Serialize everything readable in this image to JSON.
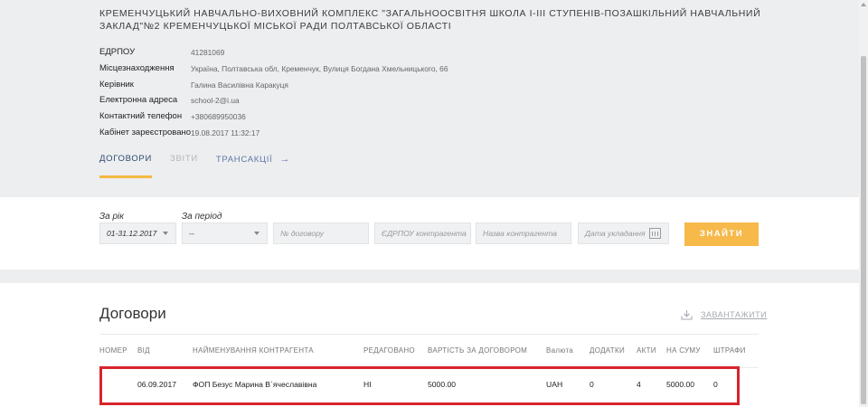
{
  "organization": {
    "title": "КРЕМЕНЧУЦЬКИЙ НАВЧАЛЬНО-ВИХОВНИЙ КОМПЛЕКС \"ЗАГАЛЬНООСВІТНЯ ШКОЛА І-ІІІ СТУПЕНІВ-ПОЗАШКІЛЬНИЙ НАВЧАЛЬНИЙ ЗАКЛАД\"№2 КРЕМЕНЧУЦЬКОЇ МІСЬКОЇ РАДИ ПОЛТАВСЬКОЇ ОБЛАСТІ",
    "info": [
      {
        "label": "ЕДРПОУ",
        "value": "41281069"
      },
      {
        "label": "Місцезнаходження",
        "value": "Україна, Полтавська обл, Кременчук, Вулиця Богдана Хмельницького, 66"
      },
      {
        "label": "Керівник",
        "value": "Галина Василівна Каракуця"
      },
      {
        "label": "Електронна адреса",
        "value": "school-2@i.ua"
      },
      {
        "label": "Контактний телефон",
        "value": "+380689950036"
      },
      {
        "label": "Кабінет зареєстровано",
        "value": "19.08.2017 11:32:17"
      }
    ]
  },
  "tabs": [
    {
      "label": "ДОГОВОРИ",
      "state": "active"
    },
    {
      "label": "ЗВІТИ",
      "state": "disabled"
    },
    {
      "label": "ТРАНСАКЦІЇ",
      "state": "link",
      "icon": "arrow-right-icon"
    }
  ],
  "filters": {
    "year_label": "За рік",
    "year_value": "01-31.12.2017",
    "period_label": "За період",
    "period_value": "--",
    "contract_number_placeholder": "№ договору",
    "edrpou_placeholder": "ЄДРПОУ контрагента",
    "counterparty_placeholder": "Назва контрагента",
    "date_placeholder": "Дата укладання",
    "search_button": "ЗНАЙТИ"
  },
  "contracts": {
    "title": "Договори",
    "download_label": "ЗАВАНТАЖИТИ",
    "columns": [
      "НОМЕР",
      "ВІД",
      "НАЙМЕНУВАННЯ КОНТРАГЕНТА",
      "РЕДАГОВАНО",
      "ВАРТІСТЬ ЗА ДОГОВОРОМ",
      "Валюта",
      "ДОДАТКИ",
      "АКТИ",
      "НА СУМУ",
      "ШТРАФИ"
    ],
    "rows": [
      {
        "number": "-",
        "date": "06.09.2017",
        "counterparty": "ФОП Безус Марина В`ячеславівна",
        "edited": "НІ",
        "amount": "5000.00",
        "currency": "UAH",
        "addenda": "0",
        "acts": "4",
        "acts_sum": "5000.00",
        "penalties": "0"
      }
    ]
  },
  "colors": {
    "accent_yellow": "#f6b94a",
    "highlight_red": "#d7242c",
    "link_blue": "#5d77a3"
  }
}
